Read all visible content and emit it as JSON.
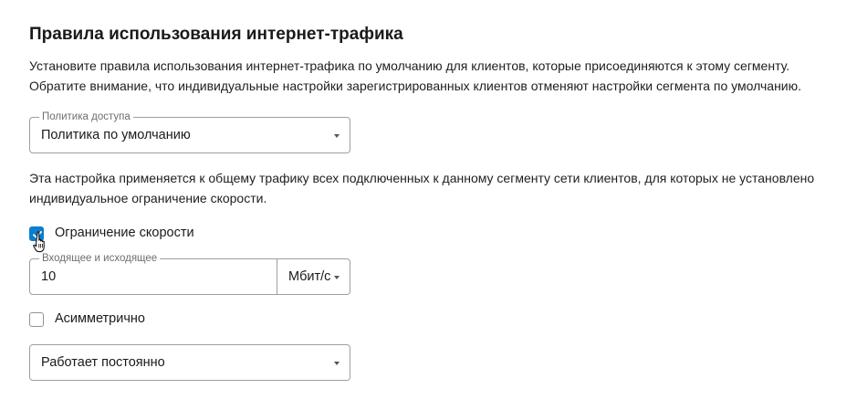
{
  "section": {
    "title": "Правила использования интернет-трафика",
    "description_lines": [
      "Установите правила использования интернет-трафика по умолчанию для клиентов, которые присоединяются к этому сегменту.",
      "Обратите внимание, что индивидуальные настройки зарегистрированных клиентов отменяют настройки сегмента по умолчанию."
    ]
  },
  "access_policy": {
    "label": "Политика доступа",
    "value": "Политика по умолчанию"
  },
  "note_lines": [
    "Эта настройка применяется к общему трафику всех подключенных к данному сегменту сети клиентов, для которых не установлено",
    "индивидуальное ограничение скорости."
  ],
  "speed_limit": {
    "label": "Ограничение скорости",
    "checked": true
  },
  "bandwidth": {
    "label": "Входящее и исходящее",
    "value": "10",
    "unit": "Мбит/с"
  },
  "asymmetric": {
    "label": "Асимметрично",
    "checked": false
  },
  "schedule": {
    "value": "Работает постоянно"
  },
  "colors": {
    "accent": "#0a7ecf",
    "border": "#9aa0a6",
    "text": "#1a1a1a"
  },
  "icons": {
    "check": "check-icon",
    "dropdown": "chevron-down-icon",
    "pointer": "hand-pointer-icon"
  }
}
